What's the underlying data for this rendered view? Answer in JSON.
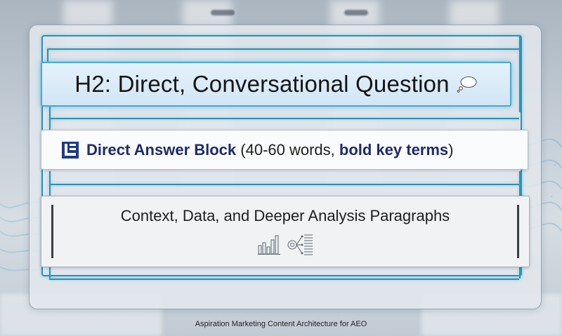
{
  "diagram": {
    "h2_block": {
      "text": "H2: Direct, Conversational Question",
      "icon": "thought-bubble-icon"
    },
    "answer_block": {
      "icon": "answer-block-icon",
      "bold_label": "Direct Answer Block",
      "detail_prefix": " (40-60 words, ",
      "detail_bold": "bold key terms",
      "detail_suffix": ")"
    },
    "context_block": {
      "text": "Context, Data, and Deeper Analysis Paragraphs",
      "icons": [
        "bar-chart-icon",
        "network-diagram-icon"
      ]
    },
    "caption": "Aspiration Marketing Content Architecture for AEO"
  },
  "colors": {
    "accent_line": "#2f8fae",
    "glow": "#48a9d0",
    "answer_bold": "#1f2a6b",
    "answer_icon": "#1f3a86"
  }
}
